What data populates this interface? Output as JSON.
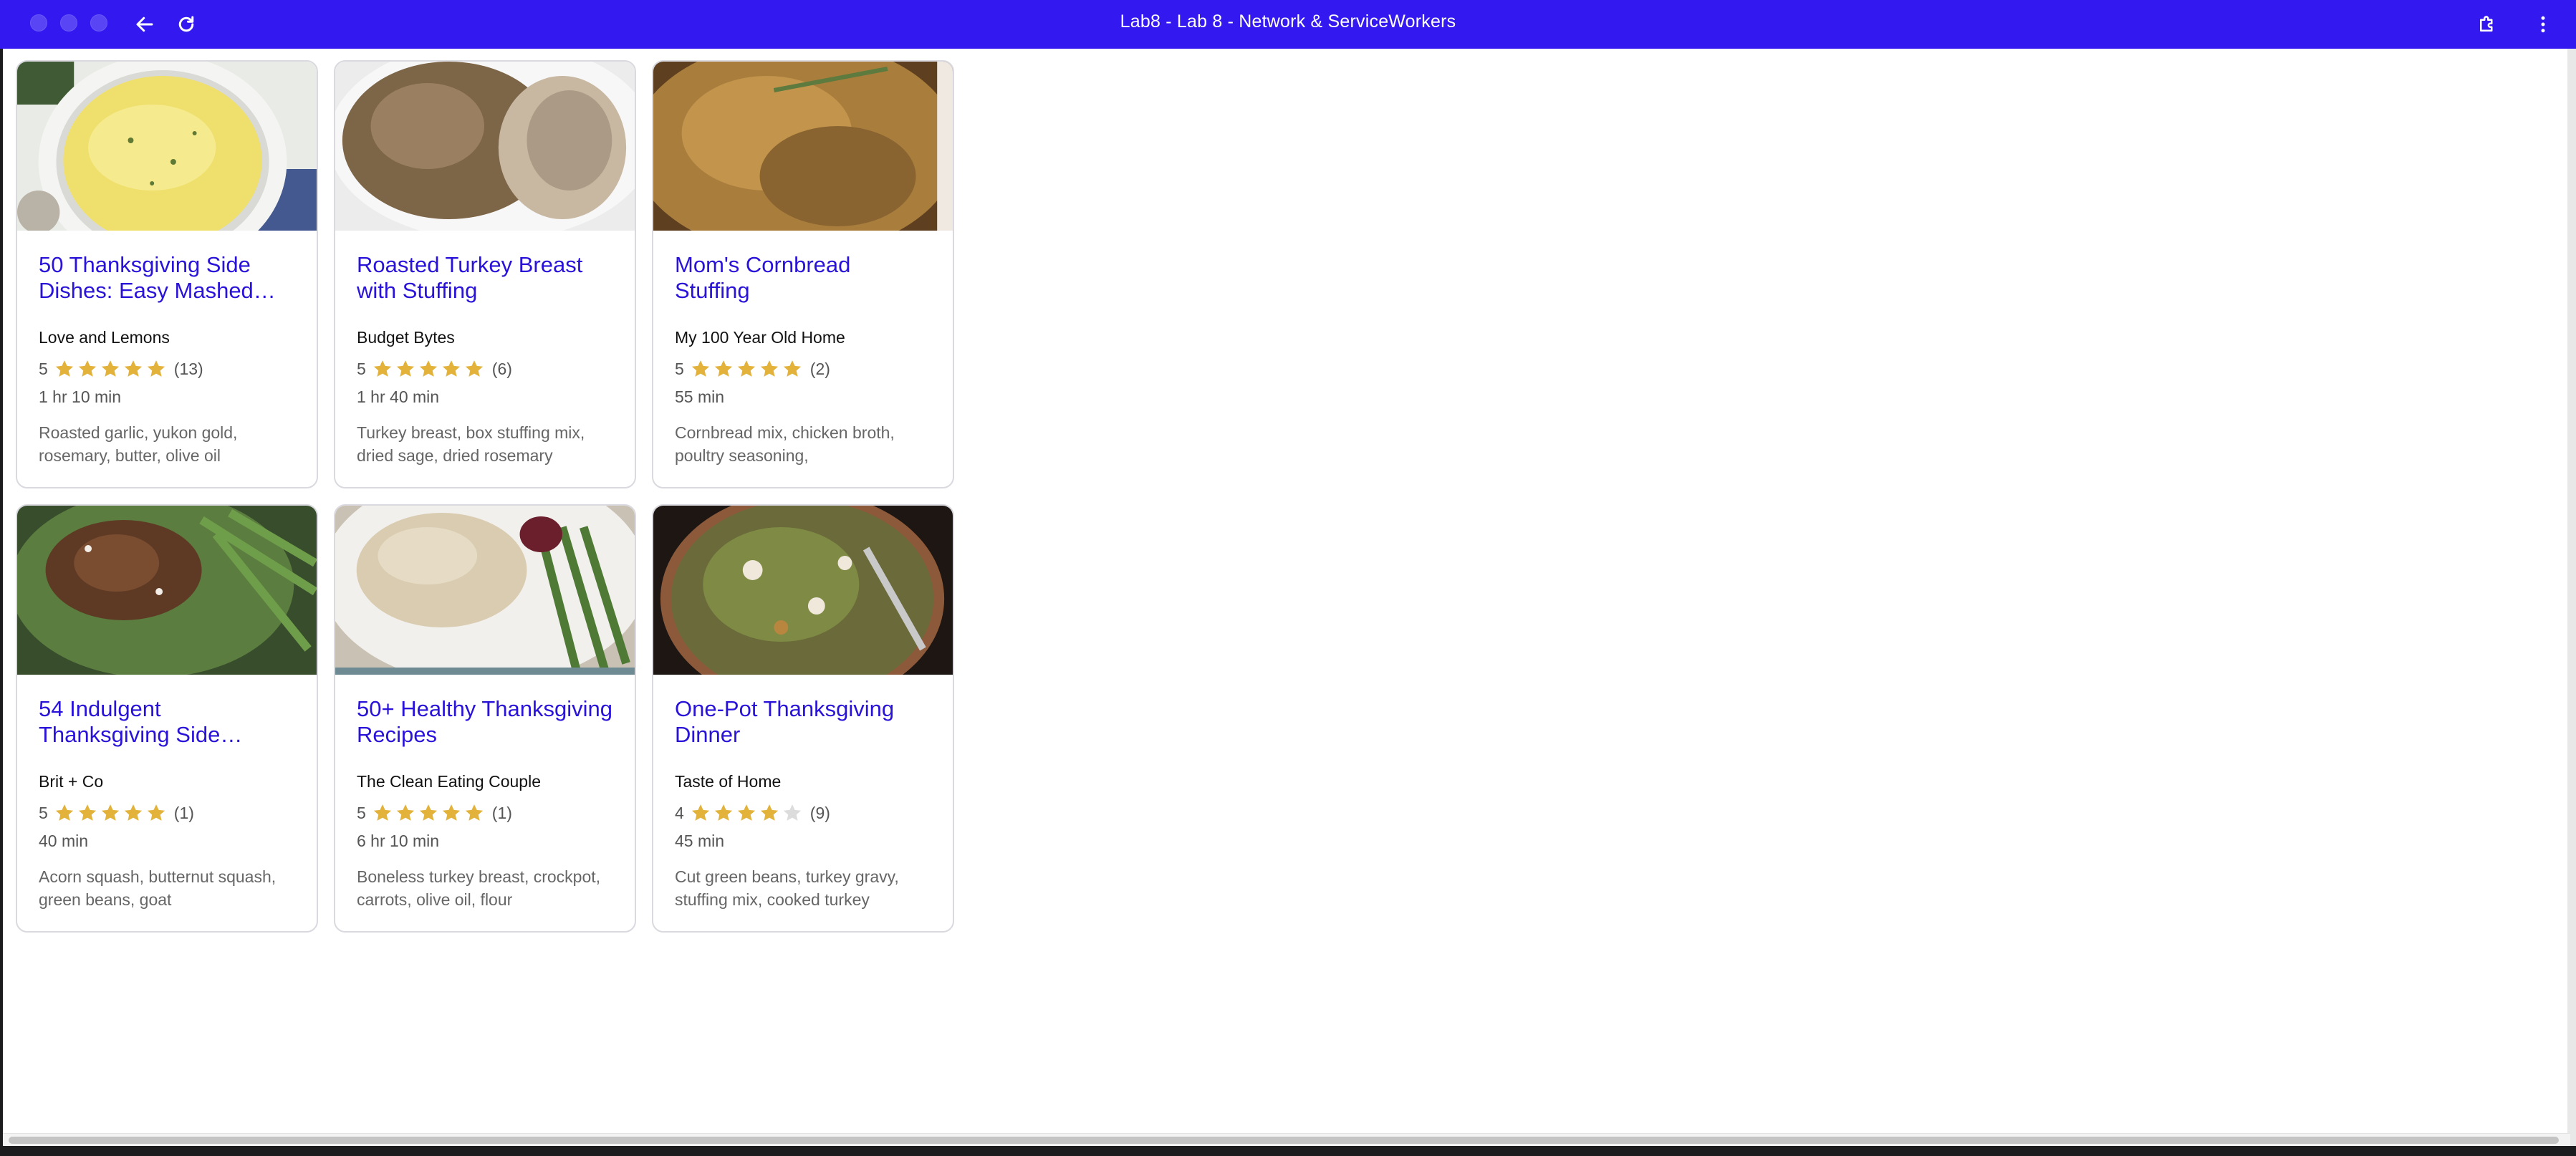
{
  "window": {
    "title": "Lab8 - Lab 8 - Network & ServiceWorkers",
    "titlebar_color": "#3318f0"
  },
  "toolbar": {
    "back_icon": "arrow-left-icon",
    "reload_icon": "reload-icon",
    "extensions_icon": "puzzle-icon",
    "menu_icon": "more-vertical-icon"
  },
  "colors": {
    "link": "#2a13d8",
    "star_filled": "#e2b23b",
    "star_empty": "#dcdcdc"
  },
  "recipes": [
    {
      "title": "50 Thanksgiving Side Dishes: Easy Mashed…",
      "org": "Love and Lemons",
      "rating": "5",
      "stars": 5,
      "reviews": "(13)",
      "time": "1 hr 10 min",
      "ingredients": "Roasted garlic, yukon gold, rosemary, butter, olive oil",
      "image": "mashed-potatoes-photo"
    },
    {
      "title": "Roasted Turkey Breast with Stuffing",
      "org": "Budget Bytes",
      "rating": "5",
      "stars": 5,
      "reviews": "(6)",
      "time": "1 hr 40 min",
      "ingredients": "Turkey breast, box stuffing mix, dried sage, dried rosemary",
      "image": "turkey-stuffing-photo"
    },
    {
      "title": "Mom's Cornbread Stuffing",
      "org": "My 100 Year Old Home",
      "rating": "5",
      "stars": 5,
      "reviews": "(2)",
      "time": "55 min",
      "ingredients": "Cornbread mix, chicken broth, poultry seasoning,",
      "image": "cornbread-stuffing-photo"
    },
    {
      "title": "54 Indulgent Thanksgiving Side…",
      "org": "Brit + Co",
      "rating": "5",
      "stars": 5,
      "reviews": "(1)",
      "time": "40 min",
      "ingredients": "Acorn squash, butternut squash, green beans, goat",
      "image": "green-beans-pecans-photo"
    },
    {
      "title": "50+ Healthy Thanksgiving Recipes",
      "org": "The Clean Eating Couple",
      "rating": "5",
      "stars": 5,
      "reviews": "(1)",
      "time": "6 hr 10 min",
      "ingredients": "Boneless turkey breast, crockpot, carrots, olive oil, flour",
      "image": "sliced-turkey-plate-photo"
    },
    {
      "title": "One-Pot Thanksgiving Dinner",
      "org": "Taste of Home",
      "rating": "4",
      "stars": 4,
      "reviews": "(9)",
      "time": "45 min",
      "ingredients": "Cut green beans, turkey gravy, stuffing mix, cooked turkey",
      "image": "one-pot-dinner-photo"
    }
  ]
}
